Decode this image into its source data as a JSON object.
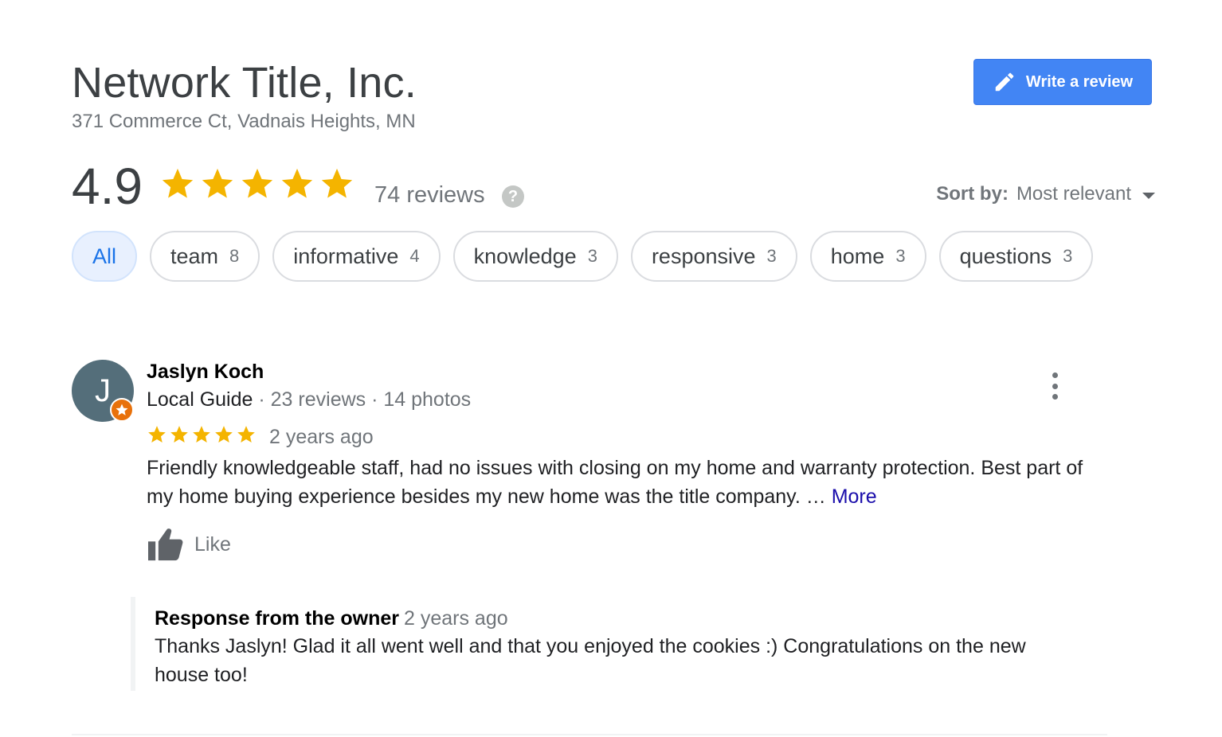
{
  "business": {
    "name": "Network Title, Inc.",
    "address": "371 Commerce Ct, Vadnais Heights, MN"
  },
  "write_review": {
    "label": "Write a review",
    "icon": "pencil-icon"
  },
  "summary": {
    "rating": "4.9",
    "stars": 5,
    "review_count": "74 reviews",
    "help_icon": "?"
  },
  "sort": {
    "label": "Sort by:",
    "value": "Most relevant"
  },
  "filters": [
    {
      "label": "All",
      "count": "",
      "active": true
    },
    {
      "label": "team",
      "count": "8"
    },
    {
      "label": "informative",
      "count": "4"
    },
    {
      "label": "knowledge",
      "count": "3"
    },
    {
      "label": "responsive",
      "count": "3"
    },
    {
      "label": "home",
      "count": "3"
    },
    {
      "label": "questions",
      "count": "3"
    }
  ],
  "review": {
    "avatar_letter": "J",
    "name": "Jaslyn Koch",
    "level": "Local Guide",
    "meta": " · 23 reviews · 14 photos",
    "stars": 5,
    "time": "2 years ago",
    "text": "Friendly knowledgeable staff, had no issues with closing on my home and warranty protection. Best part of my home buying experience besides my new home was the title company. …",
    "more": "More",
    "like": "Like",
    "owner_response": {
      "heading": "Response from the owner",
      "time": "2 years ago",
      "text": "Thanks Jaslyn! Glad it all went well and that you enjoyed the cookies :) Congratulations on the new house too!"
    }
  },
  "colors": {
    "star": "#f4b400",
    "accent": "#4285f4",
    "link": "#1a0dab",
    "chip_active_bg": "#e8f0fe"
  }
}
